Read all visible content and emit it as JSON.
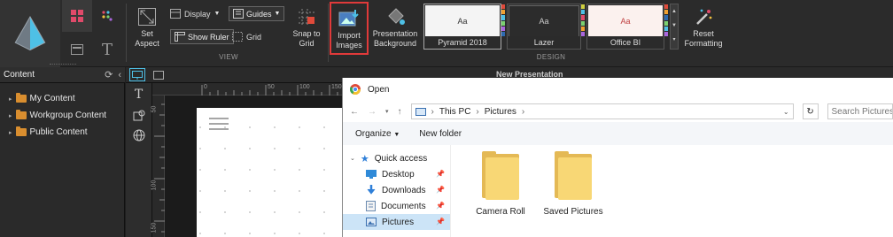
{
  "ribbon": {
    "set_aspect": "Set\nAspect",
    "display_label": "Display",
    "guides_label": "Guides",
    "show_ruler_label": "Show Ruler",
    "grid_label": "Grid",
    "snap_to_grid": "Snap to\nGrid",
    "import_images": "Import\nImages",
    "presentation_background": "Presentation\nBackground",
    "view_group": "VIEW",
    "design_group": "DESIGN",
    "reset_formatting": "Reset\nFormatting",
    "theme_sample": "Aa",
    "themes": [
      {
        "name": "Pyramid 2018"
      },
      {
        "name": "Lazer"
      },
      {
        "name": "Office BI"
      }
    ],
    "accent_color": "#e03a3a"
  },
  "content_panel": {
    "title": "Content",
    "items": [
      {
        "label": "My Content"
      },
      {
        "label": "Workgroup Content"
      },
      {
        "label": "Public Content"
      }
    ]
  },
  "presentation": {
    "title": "New Presentation",
    "ruler_top": [
      "0",
      "50",
      "100",
      "150"
    ],
    "ruler_left": [
      "50",
      "100",
      "150"
    ]
  },
  "open_dialog": {
    "title": "Open",
    "breadcrumb": [
      "This PC",
      "Pictures"
    ],
    "search_placeholder": "Search Pictures",
    "organize_label": "Organize",
    "new_folder_label": "New folder",
    "nav_items": [
      {
        "label": "Quick access",
        "icon": "star-icon"
      },
      {
        "label": "Desktop",
        "icon": "desktop-icon"
      },
      {
        "label": "Downloads",
        "icon": "download-icon"
      },
      {
        "label": "Documents",
        "icon": "documents-icon"
      },
      {
        "label": "Pictures",
        "icon": "pictures-icon"
      }
    ],
    "files": [
      {
        "name": "Camera Roll"
      },
      {
        "name": "Saved Pictures"
      }
    ]
  }
}
